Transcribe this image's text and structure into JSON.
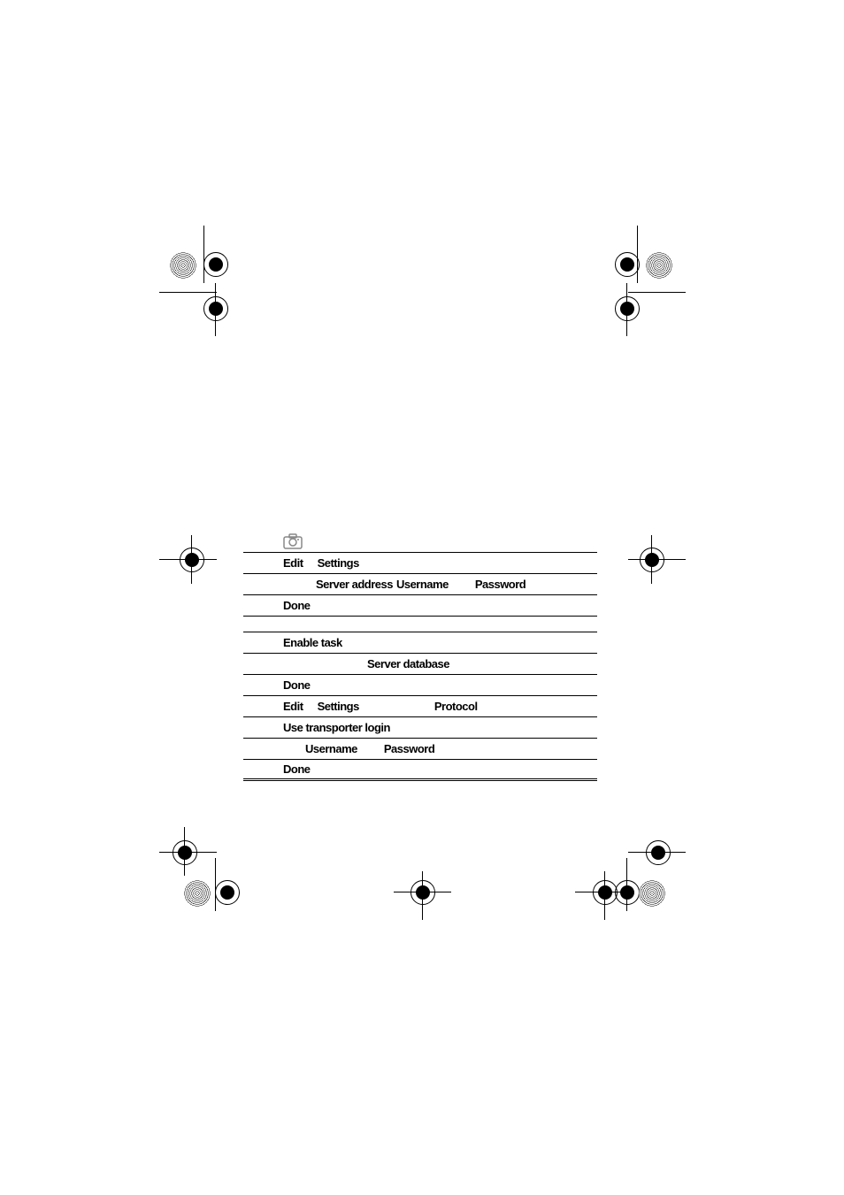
{
  "content": {
    "edit1": "Edit",
    "settings1": "Settings",
    "server_address": "Server address",
    "username1": "Username",
    "password1": "Password",
    "done1": "Done",
    "enable_task": "Enable task",
    "server_database": "Server database",
    "done2": "Done",
    "edit2": "Edit",
    "settings2": "Settings",
    "protocol": "Protocol",
    "use_transporter_login": "Use transporter login",
    "username2": "Username",
    "password2": "Password",
    "done3": "Done"
  }
}
